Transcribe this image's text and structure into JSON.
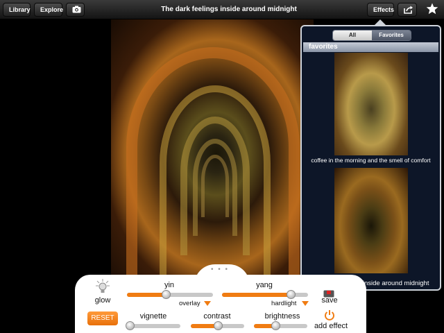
{
  "toolbar": {
    "library_label": "Library",
    "explore_label": "Explore",
    "camera_icon": "camera-icon",
    "title": "The dark feelings inside around midnight",
    "effects_label": "Effects",
    "share_icon": "share-icon",
    "star_icon": "star-icon"
  },
  "effects_popover": {
    "tabs": [
      "All",
      "Favorites"
    ],
    "selected_tab": "Favorites",
    "section_header": "favorites",
    "items": [
      {
        "caption": "coffee in the morning and the smell of comfort"
      },
      {
        "caption": "the dark feelings inside around midnight"
      }
    ]
  },
  "controls": {
    "glow_label": "glow",
    "reset_label": "RESET",
    "save_label": "save",
    "add_effect_label": "add effect",
    "sliders": [
      {
        "label": "yin",
        "value": 0.45,
        "blend": ""
      },
      {
        "label": "yang",
        "value": 0.8,
        "blend": ""
      },
      {
        "label": "vignette",
        "value": 0.05,
        "blend": ""
      },
      {
        "label": "contrast",
        "value": 0.5,
        "blend": ""
      },
      {
        "label": "brightness",
        "value": 0.4,
        "blend": ""
      }
    ],
    "blend_modes": {
      "yin": "overlay",
      "yang": "hardlight"
    }
  },
  "colors": {
    "accent": "#f07c12",
    "popover_bg": "#0d1628",
    "toolbar_bg": "#1e1e1e"
  }
}
